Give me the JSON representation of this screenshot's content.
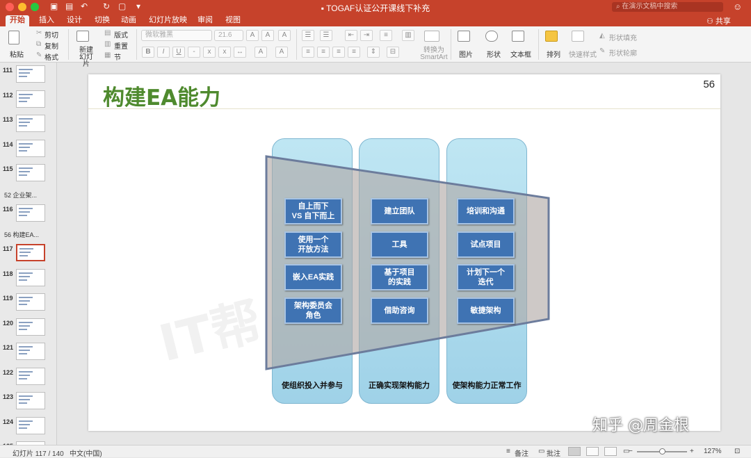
{
  "window": {
    "title": "TOGAF认证公开课线下补充",
    "search_placeholder": "在演示文稿中搜索",
    "share_label": "共享"
  },
  "tabs": [
    "开始",
    "插入",
    "设计",
    "切换",
    "动画",
    "幻灯片放映",
    "审阅",
    "视图"
  ],
  "ribbon": {
    "paste": "粘贴",
    "cut": "剪切",
    "copy": "复制",
    "format": "格式",
    "new_slide": "新建\n幻灯片",
    "layout": "版式",
    "reset": "重置",
    "section": "节",
    "font_name": "微软雅黑",
    "font_size": "21.6",
    "convert_smartart": "转换为\nSmartArt",
    "picture": "图片",
    "shape": "形状",
    "textbox": "文本框",
    "arrange": "排列",
    "quick_styles": "快速样式",
    "shape_fill": "形状填充",
    "shape_outline": "形状轮廓"
  },
  "left_panel": {
    "items": [
      {
        "type": "slide",
        "num": "111"
      },
      {
        "type": "slide",
        "num": "112"
      },
      {
        "type": "slide",
        "num": "113"
      },
      {
        "type": "slide",
        "num": "114"
      },
      {
        "type": "slide",
        "num": "115"
      },
      {
        "type": "section",
        "label": "52 企业架..."
      },
      {
        "type": "slide",
        "num": "116"
      },
      {
        "type": "section",
        "label": "56 构建EA..."
      },
      {
        "type": "slide",
        "num": "117",
        "selected": true
      },
      {
        "type": "slide",
        "num": "118"
      },
      {
        "type": "slide",
        "num": "119"
      },
      {
        "type": "slide",
        "num": "120"
      },
      {
        "type": "slide",
        "num": "121"
      },
      {
        "type": "slide",
        "num": "122"
      },
      {
        "type": "slide",
        "num": "123"
      },
      {
        "type": "slide",
        "num": "124"
      },
      {
        "type": "slide",
        "num": "125"
      }
    ]
  },
  "slide": {
    "title": "构建EA能力",
    "page_number": "56",
    "watermark": "IT帮",
    "columns": [
      {
        "label": "使组织投入并参与",
        "cells": [
          "自上而下\nVS 自下而上",
          "使用一个\n开放方法",
          "嵌入EA实践",
          "架构委员会\n角色"
        ]
      },
      {
        "label": "正确实现架构能力",
        "cells": [
          "建立团队",
          "工具",
          "基于项目\n的实践",
          "借助咨询"
        ]
      },
      {
        "label": "使架构能力正常工作",
        "cells": [
          "培训和沟通",
          "试点项目",
          "计划下一个\n迭代",
          "敏捷架构"
        ]
      }
    ]
  },
  "overlay_watermark": "知乎 @周金根",
  "status": {
    "slide_counter": "幻灯片 117 / 140",
    "language": "中文(中国)",
    "notes": "备注",
    "comments": "批注",
    "zoom": "127%"
  },
  "colors": {
    "accent": "#c6422b",
    "title_green": "#4f8a2e",
    "cell_blue": "#3f73b3",
    "column_blue": "#a8d8ec"
  }
}
